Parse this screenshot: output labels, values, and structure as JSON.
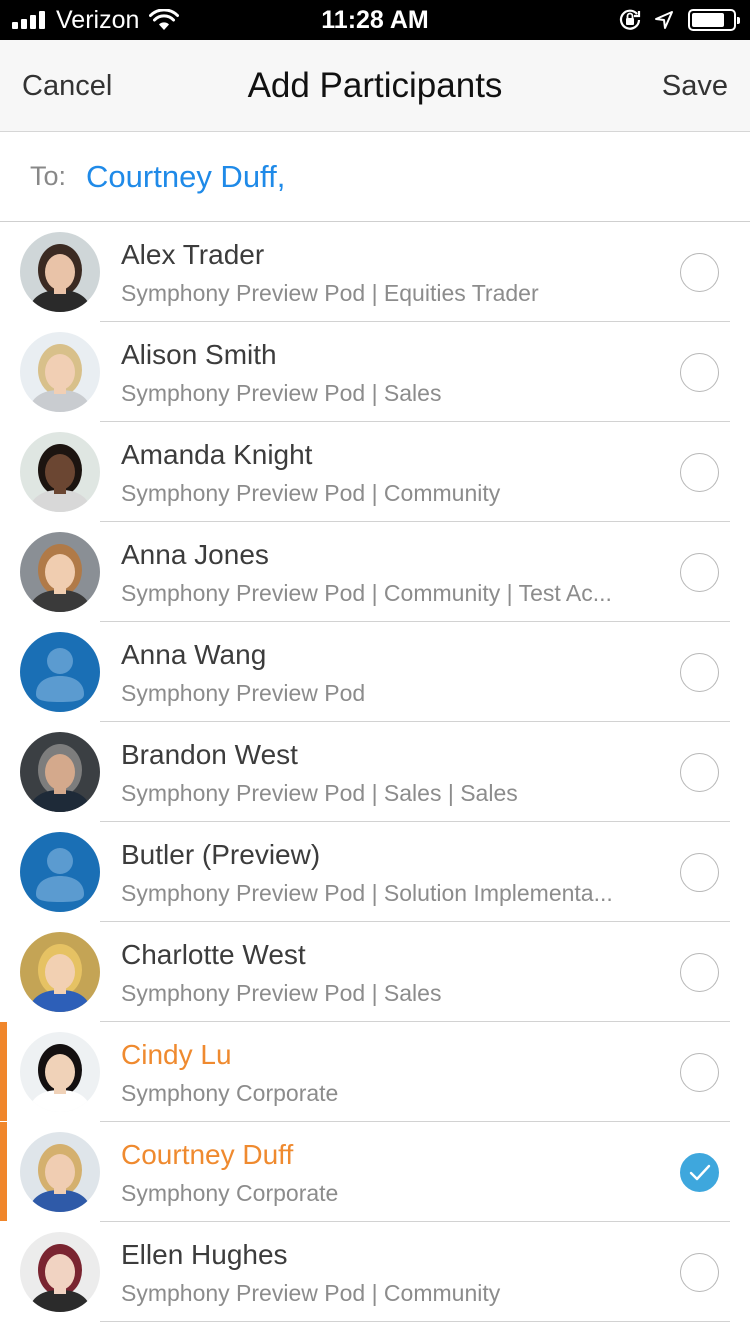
{
  "status_bar": {
    "carrier": "Verizon",
    "time": "11:28 AM",
    "battery_level": 0.8
  },
  "nav": {
    "cancel_label": "Cancel",
    "title": "Add Participants",
    "save_label": "Save"
  },
  "to_field": {
    "label": "To:",
    "value": "Courtney Duff,"
  },
  "colors": {
    "link_blue": "#1f8ae8",
    "highlight_orange": "#ef8a2f",
    "check_blue": "#3ea7dd",
    "default_avatar_blue": "#1a6fb5"
  },
  "contacts": [
    {
      "name": "Alex Trader",
      "subtitle": "Symphony Preview Pod | Equities Trader",
      "avatar": "photo",
      "selected": false,
      "highlight": false
    },
    {
      "name": "Alison Smith",
      "subtitle": "Symphony Preview Pod | Sales",
      "avatar": "photo",
      "selected": false,
      "highlight": false
    },
    {
      "name": "Amanda Knight",
      "subtitle": "Symphony Preview Pod | Community",
      "avatar": "photo",
      "selected": false,
      "highlight": false
    },
    {
      "name": "Anna Jones",
      "subtitle": "Symphony Preview Pod | Community | Test Ac...",
      "avatar": "photo",
      "selected": false,
      "highlight": false
    },
    {
      "name": "Anna Wang",
      "subtitle": "Symphony Preview Pod",
      "avatar": "default-user-icon",
      "selected": false,
      "highlight": false
    },
    {
      "name": "Brandon West",
      "subtitle": "Symphony Preview Pod | Sales | Sales",
      "avatar": "photo",
      "selected": false,
      "highlight": false
    },
    {
      "name": "Butler (Preview)",
      "subtitle": "Symphony Preview Pod | Solution Implementa...",
      "avatar": "default-user-icon",
      "selected": false,
      "highlight": false
    },
    {
      "name": "Charlotte West",
      "subtitle": "Symphony Preview Pod | Sales",
      "avatar": "photo",
      "selected": false,
      "highlight": false
    },
    {
      "name": "Cindy Lu",
      "subtitle": "Symphony Corporate",
      "avatar": "photo",
      "selected": false,
      "highlight": true
    },
    {
      "name": "Courtney Duff",
      "subtitle": "Symphony Corporate",
      "avatar": "photo",
      "selected": true,
      "highlight": true
    },
    {
      "name": "Ellen Hughes",
      "subtitle": "Symphony Preview Pod | Community",
      "avatar": "photo",
      "selected": false,
      "highlight": false
    }
  ]
}
